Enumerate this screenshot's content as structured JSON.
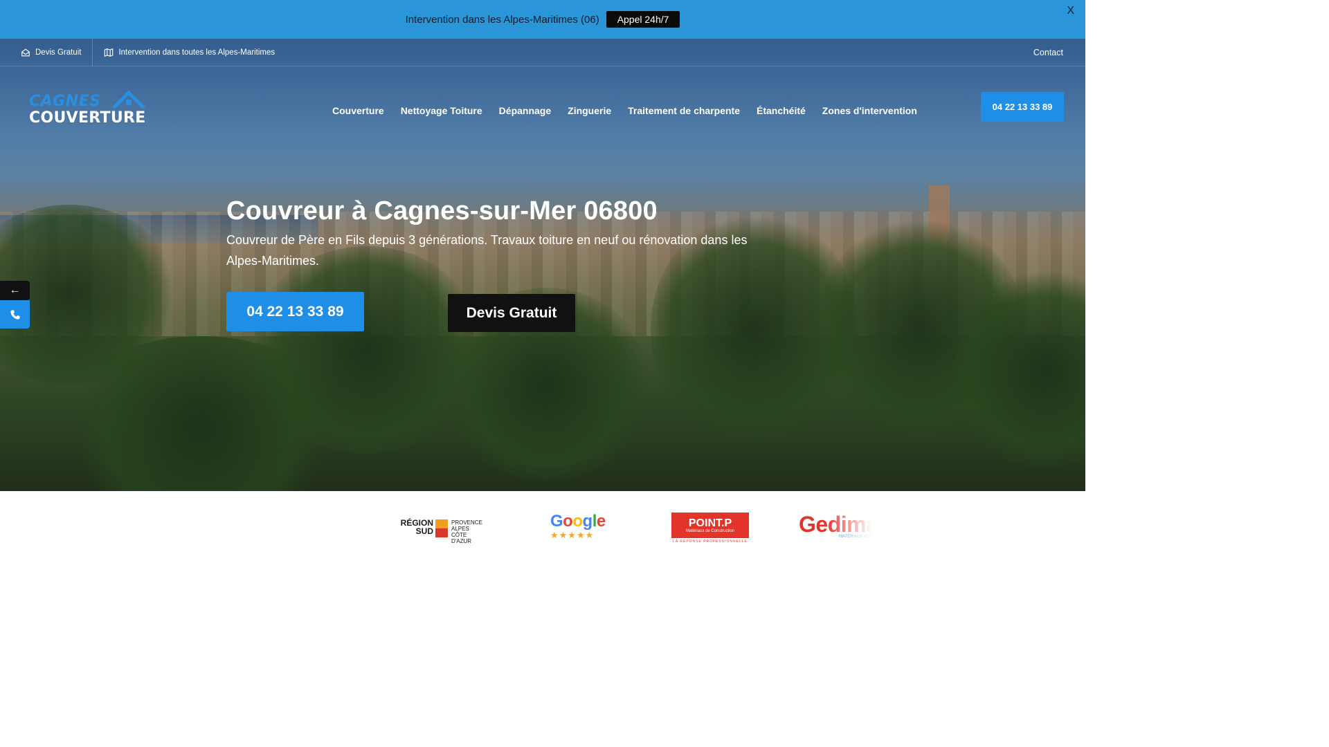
{
  "announcement": {
    "text": "Intervention dans les Alpes-Maritimes (06)",
    "button_label": "Appel 24h/7",
    "close_label": "X"
  },
  "topbar": {
    "devis_label": "Devis Gratuit",
    "devis_icon": "envelope-open-icon",
    "zone_label": "Intervention dans toutes les Alpes-Maritimes",
    "zone_icon": "map-icon",
    "contact_label": "Contact"
  },
  "logo": {
    "line1": "CAGNES",
    "line2": "COUVERTURE"
  },
  "nav": {
    "items": [
      "Couverture",
      "Nettoyage Toiture",
      "Dépannage",
      "Zinguerie",
      "Traitement de charpente",
      "Étanchéité",
      "Zones d'intervention"
    ],
    "phone_button": "04 22 13 33 89"
  },
  "hero": {
    "title": "Couvreur à Cagnes-sur-Mer 06800",
    "subtitle": "Couvreur de Père en Fils depuis 3 générations. Travaux toiture en neuf ou rénovation dans les Alpes-Maritimes.",
    "phone_button": "04 22 13 33 89",
    "devis_button": "Devis Gratuit"
  },
  "side_widget": {
    "arrow": "←",
    "phone_icon": "phone-icon"
  },
  "partners": {
    "region": {
      "name_line1": "RÉGION",
      "name_line2": "SUD",
      "detail_line1": "PROVENCE",
      "detail_line2": "ALPES",
      "detail_line3": "CÔTE D'AZUR"
    },
    "google": {
      "name": "Google",
      "stars": "★★★★★"
    },
    "pointp": {
      "name": "POINT.P",
      "detail": "Matériaux de Construction",
      "tagline": "LA RÉPONSE PROFESSIONNELLE"
    },
    "gedimat": {
      "name": "Gedima",
      "detail": "MATÉRIAUX & BRI"
    }
  },
  "colors": {
    "announce_bg": "#2a96d8",
    "accent_blue": "#1e8ee6",
    "dark_button": "#111111",
    "pointp_red": "#e3342b"
  }
}
